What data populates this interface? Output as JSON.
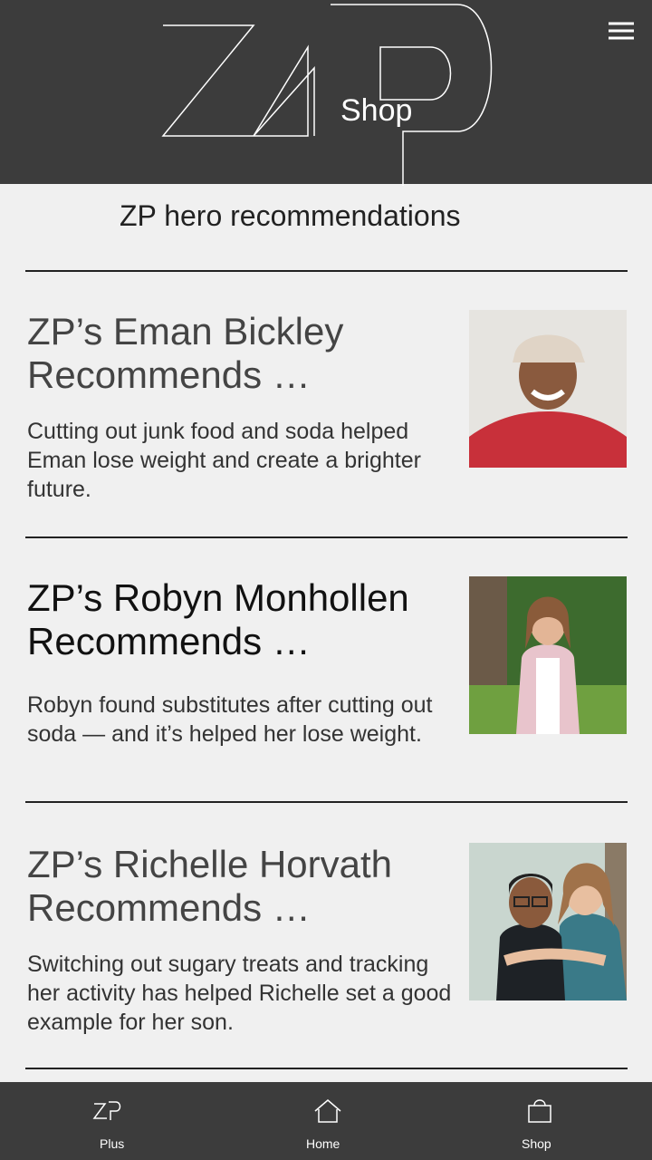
{
  "header": {
    "logo_icon": "zp-logo",
    "title": "Shop",
    "menu_icon": "hamburger-menu-icon",
    "background": "#3c3c3c"
  },
  "headline": "ZP hero recommendations",
  "cards": [
    {
      "title": "ZP’s Eman Bickley Recommends …",
      "description": "Cutting out junk food and soda helped Eman lose weight and create a brighter future.",
      "photo_icon": "portrait-photo"
    },
    {
      "title": "ZP’s Robyn Monhollen Recommends …",
      "description": "Robyn found substitutes after cutting out soda — and it’s helped her lose weight.",
      "photo_icon": "portrait-photo"
    },
    {
      "title": "ZP’s Richelle Horvath Recommends …",
      "description": "Switching out sugary treats and tracking her activity has helped Richelle set a good example for her son.",
      "photo_icon": "portrait-photo"
    }
  ],
  "bottom_nav": [
    {
      "label": "Plus",
      "icon": "zp-plus-icon"
    },
    {
      "label": "Home",
      "icon": "home-icon"
    },
    {
      "label": "Shop",
      "icon": "shop-bag-icon"
    }
  ],
  "colors": {
    "header_bg": "#3c3c3c",
    "page_bg": "#f0f0f0",
    "text": "#333333"
  }
}
